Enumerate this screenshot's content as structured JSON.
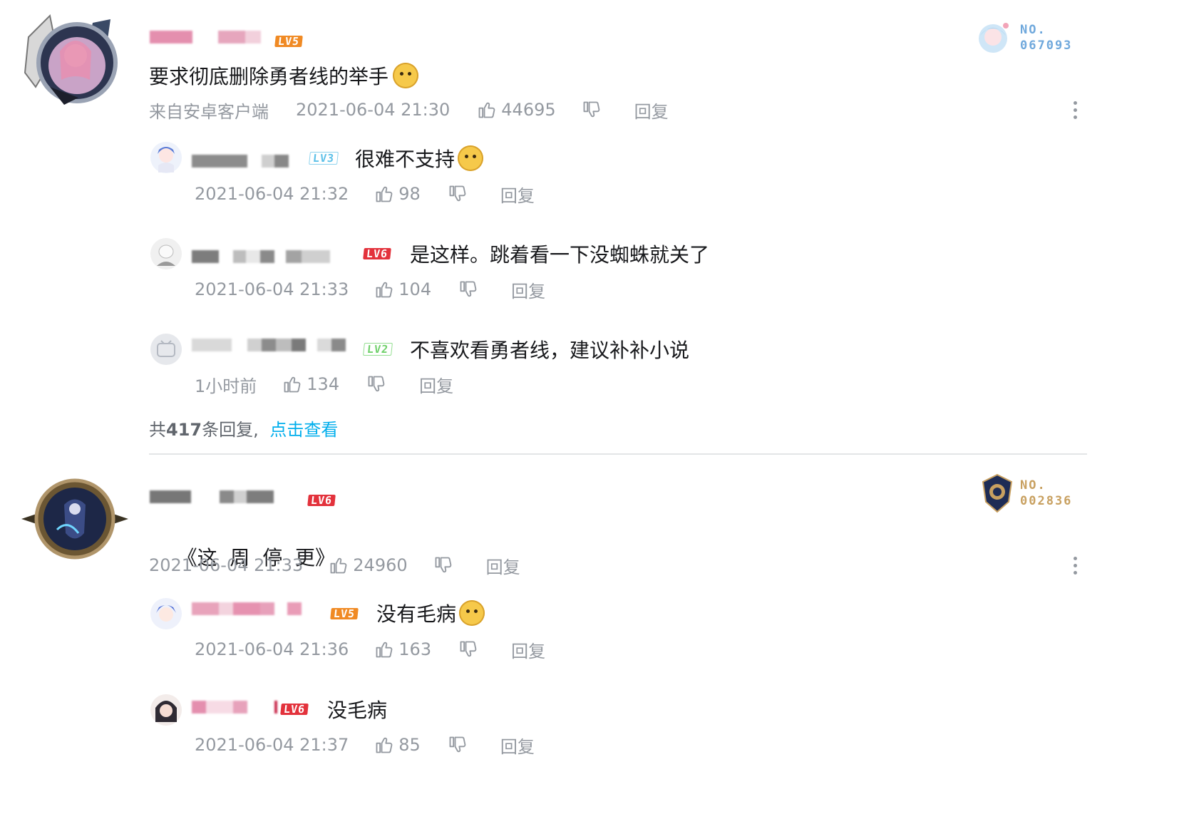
{
  "comments": [
    {
      "level": "LV5",
      "content": "要求彻底删除勇者线的举手",
      "emoji": "doge-emoji",
      "source": "来自安卓客户端",
      "time": "2021-06-04 21:30",
      "likes": "44695",
      "reply_label": "回复",
      "fan_badge": {
        "label": "NO.",
        "number": "067093",
        "color": "#6fa8dc"
      },
      "replies": [
        {
          "level": "LV3",
          "content": "很难不支持",
          "emoji": "doge-rose-emoji",
          "time": "2021-06-04 21:32",
          "likes": "98",
          "reply_label": "回复"
        },
        {
          "level": "LV6",
          "content": "是这样。跳着看一下没蜘蛛就关了",
          "time": "2021-06-04 21:33",
          "likes": "104",
          "reply_label": "回复"
        },
        {
          "level": "LV2",
          "content": "不喜欢看勇者线，建议补补小说",
          "time": "1小时前",
          "likes": "134",
          "reply_label": "回复"
        }
      ],
      "summary": {
        "prefix": "共",
        "count": "417",
        "suffix": "条回复,",
        "link": "点击查看"
      }
    },
    {
      "level": "LV6",
      "content": "《这  周  停  更》",
      "time": "2021-06-04 21:33",
      "likes": "24960",
      "reply_label": "回复",
      "fan_badge": {
        "label": "NO.",
        "number": "002836",
        "color": "#c8a060"
      },
      "replies": [
        {
          "level": "LV5",
          "content": "没有毛病",
          "emoji": "thinking-emoji",
          "time": "2021-06-04 21:36",
          "likes": "163",
          "reply_label": "回复"
        },
        {
          "level": "LV6",
          "content": "没毛病",
          "time": "2021-06-04 21:37",
          "likes": "85",
          "reply_label": "回复"
        }
      ]
    }
  ],
  "colors": {
    "text": "#18191c",
    "meta": "#9499a0",
    "link": "#00aeec",
    "divider": "#e3e5e7",
    "lv2": "#6fd06a",
    "lv3": "#5cc0e8",
    "lv5": "#f08a24",
    "lv6": "#e3323c"
  }
}
